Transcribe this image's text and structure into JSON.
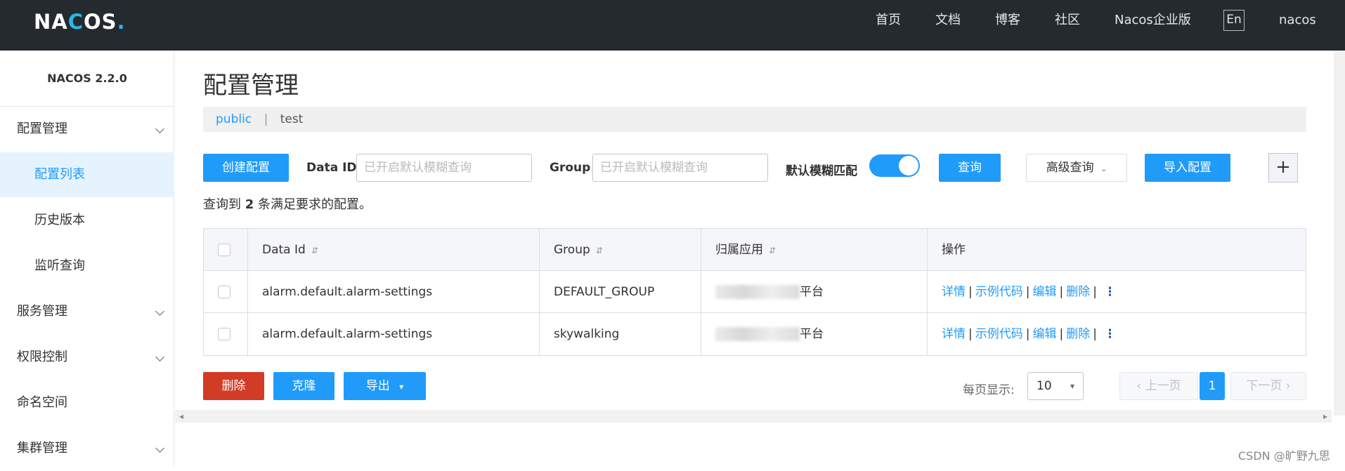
{
  "header": {
    "logo": "NACOS.",
    "nav": [
      "首页",
      "文档",
      "博客",
      "社区",
      "Nacos企业版"
    ],
    "lang": "En",
    "user": "nacos"
  },
  "sidebar": {
    "version": "NACOS 2.2.0",
    "items": [
      {
        "label": "配置管理",
        "type": "group"
      },
      {
        "label": "配置列表",
        "type": "sub",
        "active": true
      },
      {
        "label": "历史版本",
        "type": "sub"
      },
      {
        "label": "监听查询",
        "type": "sub"
      },
      {
        "label": "服务管理",
        "type": "group"
      },
      {
        "label": "权限控制",
        "type": "group"
      },
      {
        "label": "命名空间",
        "type": "plain"
      },
      {
        "label": "集群管理",
        "type": "group"
      }
    ]
  },
  "main": {
    "title": "配置管理",
    "namespaces": {
      "active": "public",
      "separator": "|",
      "other": "test"
    },
    "toolbar": {
      "create_label": "创建配置",
      "dataid_label": "Data ID",
      "dataid_placeholder": "已开启默认模糊查询",
      "group_label": "Group",
      "group_placeholder": "已开启默认模糊查询",
      "fuzzy_label": "默认模糊匹配",
      "fuzzy_on": true,
      "query_label": "查询",
      "advanced_label": "高级查询",
      "import_label": "导入配置",
      "plus_label": "+"
    },
    "summary": {
      "prefix": "查询到",
      "count": "2",
      "suffix": "条满足要求的配置。"
    },
    "table": {
      "headers": [
        "Data Id",
        "Group",
        "归属应用",
        "操作"
      ],
      "rows": [
        {
          "data_id": "alarm.default.alarm-settings",
          "group": "DEFAULT_GROUP",
          "app_suffix": "平台"
        },
        {
          "data_id": "alarm.default.alarm-settings",
          "group": "skywalking",
          "app_suffix": "平台"
        }
      ],
      "ops": [
        "详情",
        "示例代码",
        "编辑",
        "删除"
      ],
      "op_sep": "|",
      "more": "⋮"
    },
    "footer": {
      "delete_label": "删除",
      "clone_label": "克隆",
      "export_label": "导出",
      "page_size_label": "每页显示:",
      "page_size": "10",
      "prev_label": "上一页",
      "current_page": "1",
      "next_label": "下一页"
    }
  },
  "watermark": "CSDN @旷野九思",
  "colors": {
    "primary": "#209bfa",
    "danger": "#d23c26",
    "topbar": "#252a2f",
    "active_bg": "#e5f3ff"
  }
}
